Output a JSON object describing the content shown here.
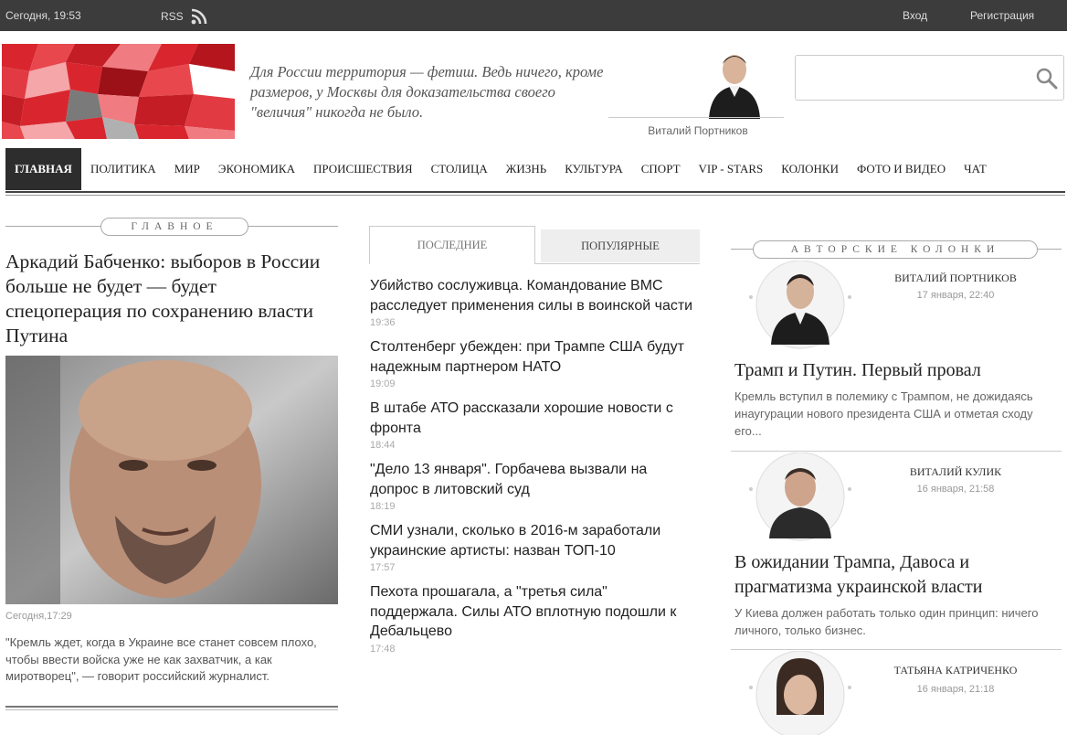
{
  "topbar": {
    "date": "Сегодня, 19:53",
    "rss_label": "RSS",
    "rss_icon": "rss-icon",
    "login": "Вход",
    "register": "Регистрация"
  },
  "header": {
    "quote": "Для России территория — фетиш. Ведь ничего, кроме размеров, у Москвы для доказательства своего \"величия\" никогда не было.",
    "quote_author": "Виталий Портников",
    "search": {
      "value": "",
      "placeholder": "",
      "icon": "search-icon"
    }
  },
  "nav": {
    "items": [
      {
        "label": "ГЛАВНАЯ",
        "active": true
      },
      {
        "label": "ПОЛИТИКА"
      },
      {
        "label": "МИР"
      },
      {
        "label": "ЭКОНОМИКА"
      },
      {
        "label": "ПРОИСШЕСТВИЯ"
      },
      {
        "label": "СТОЛИЦА"
      },
      {
        "label": "ЖИЗНЬ"
      },
      {
        "label": "КУЛЬТУРА"
      },
      {
        "label": "СПОРТ"
      },
      {
        "label": "VIP - STARS"
      },
      {
        "label": "КОЛОНКИ"
      },
      {
        "label": "ФОТО И ВИДЕО"
      },
      {
        "label": "ЧАТ"
      }
    ]
  },
  "main": {
    "section_label": "ГЛАВНОЕ",
    "title": "Аркадий Бабченко: выборов в России больше не будет — будет спецоперация по сохранению власти Путина",
    "time": "Сегодня,17:29",
    "lead": "\"Кремль ждет, когда в Украине все станет совсем плохо, чтобы ввести войска уже не как захватчик, а как миротворец\", — говорит российский журналист."
  },
  "tabs": {
    "latest": "ПОСЛЕДНИЕ",
    "popular": "ПОПУЛЯРНЫЕ"
  },
  "news": [
    {
      "title": "Убийство сослуживца. Командование ВМС расследует применения силы в воинской части",
      "time": "19:36"
    },
    {
      "title": "Столтенберг убежден: при Трампе США будут надежным партнером НАТО",
      "time": "19:09"
    },
    {
      "title": "В штабе АТО рассказали хорошие новости с фронта",
      "time": "18:44"
    },
    {
      "title": "\"Дело 13 января\". Горбачева вызвали на допрос в литовский суд",
      "time": "18:19"
    },
    {
      "title": "СМИ узнали, сколько в 2016-м заработали украинские артисты: назван ТОП-10",
      "time": "17:57"
    },
    {
      "title": "Пехота прошагала, а \"третья сила\" поддержала. Силы АТО вплотную подошли к Дебальцево",
      "time": "17:48"
    }
  ],
  "columns": {
    "section_label": "АВТОРСКИЕ КОЛОНКИ",
    "items": [
      {
        "author": "ВИТАЛИЙ ПОРТНИКОВ",
        "date": "17 января, 22:40",
        "title": "Трамп и Путин. Первый провал",
        "lead": "Кремль вступил в полемику с Трампом, не дожидаясь инаугурации нового президента США и отметая сходу его..."
      },
      {
        "author": "ВИТАЛИЙ КУЛИК",
        "date": "16 января, 21:58",
        "title": "В ожидании Трампа, Давоса и прагматизма украинской власти",
        "lead": "У Киева должен работать только один принцип: ничего личного, только бизнес."
      },
      {
        "author": "ТАТЬЯНА КАТРИЧЕНКО",
        "date": "16 января, 21:18",
        "title": "",
        "lead": ""
      }
    ]
  },
  "colors": {
    "topbar_bg": "#3c3c3c",
    "nav_active_bg": "#2d2d2d",
    "logo_red": "#d9262e"
  }
}
